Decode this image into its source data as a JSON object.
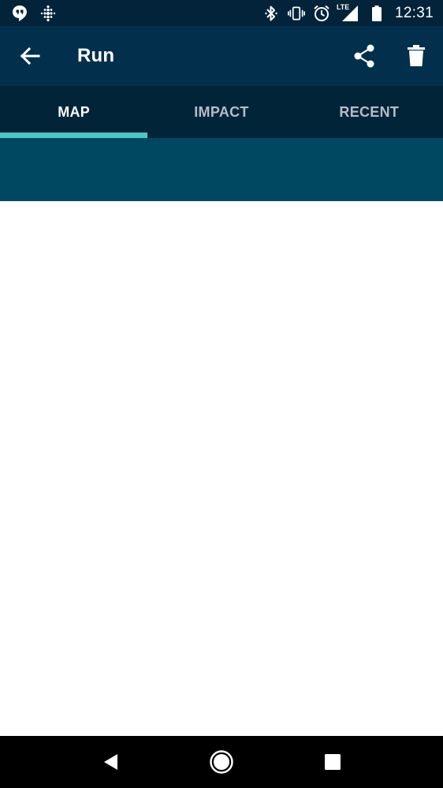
{
  "status_bar": {
    "time": "12:31",
    "network_label": "LTE",
    "left_icons": [
      "hangouts-icon",
      "fitbit-icon"
    ],
    "right_icons": [
      "bluetooth-icon",
      "vibrate-icon",
      "alarm-icon",
      "signal-icon",
      "battery-icon"
    ]
  },
  "app_bar": {
    "title": "Run",
    "actions": [
      "share-icon",
      "delete-icon"
    ]
  },
  "tabs": [
    {
      "label": "MAP",
      "active": true
    },
    {
      "label": "IMPACT",
      "active": false
    },
    {
      "label": "RECENT",
      "active": false
    }
  ],
  "colors": {
    "status_bar": "#02233a",
    "app_bar": "#02304c",
    "tab_bar": "#022439",
    "tab_indicator": "#4cc7c3",
    "banner": "#004862"
  },
  "nav_bar": {
    "buttons": [
      "back-triangle-icon",
      "home-circle-icon",
      "recents-square-icon"
    ]
  }
}
